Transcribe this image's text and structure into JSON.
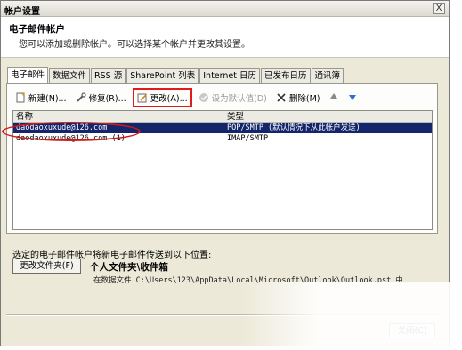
{
  "window": {
    "title": "帐户设置",
    "close_glyph": "X"
  },
  "header": {
    "title": "电子邮件帐户",
    "description": "您可以添加或删除帐户。可以选择某个帐户并更改其设置。"
  },
  "tabs": [
    {
      "label": "电子邮件",
      "active": true
    },
    {
      "label": "数据文件"
    },
    {
      "label": "RSS 源"
    },
    {
      "label": "SharePoint 列表"
    },
    {
      "label": "Internet 日历"
    },
    {
      "label": "已发布日历"
    },
    {
      "label": "通讯簿"
    }
  ],
  "toolbar": {
    "new_label": "新建(N)...",
    "new_icon": "new-icon",
    "repair_label": "修复(R)...",
    "repair_icon": "repair-icon",
    "change_label": "更改(A)...",
    "change_icon": "change-icon",
    "set_default_label": "设为默认值(D)",
    "set_default_icon": "check-icon",
    "remove_label": "删除(M)",
    "remove_icon": "delete-icon",
    "up_icon": "up-arrow-icon",
    "down_icon": "down-arrow-icon"
  },
  "accounts": {
    "columns": {
      "name": "名称",
      "type": "类型"
    },
    "rows": [
      {
        "name": "daodaoxuxude@126.com",
        "type": "POP/SMTP (默认情况下从此帐户发送)",
        "selected": true
      },
      {
        "name": "daodaoxuxude@126.com (1)",
        "type": "IMAP/SMTP",
        "selected": false
      }
    ]
  },
  "delivery": {
    "label": "选定的电子邮件帐户将新电子邮件传送到以下位置:",
    "change_folder_label": "更改文件夹(F)",
    "folder_name": "个人文件夹\\收件箱",
    "folder_path": "在数据文件 C:\\Users\\123\\AppData\\Local\\Microsoft\\Outlook\\Outlook.pst 中"
  },
  "footer": {
    "close_label": "关闭(C)"
  },
  "colors": {
    "highlight_red": "#e21a1a",
    "selection_blue": "#14256b",
    "dialog_bg": "#ece9d8"
  }
}
